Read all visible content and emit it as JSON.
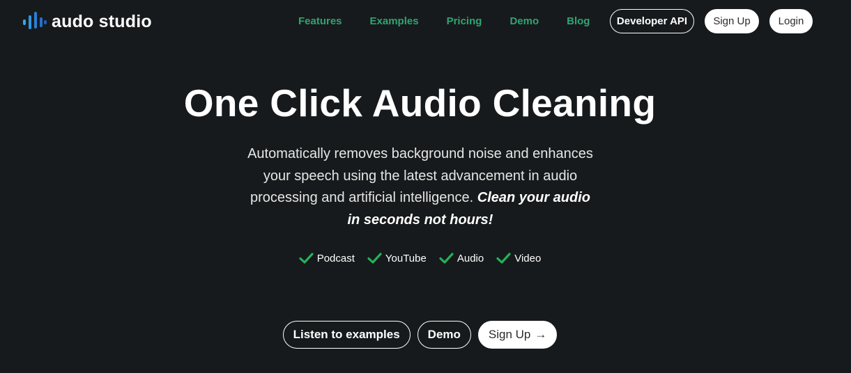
{
  "brand": {
    "name": "audo studio",
    "logo_colors": [
      "#3aa3e8",
      "#2c7fd4",
      "#1f5fc2"
    ]
  },
  "nav": {
    "items": [
      {
        "label": "Features"
      },
      {
        "label": "Examples"
      },
      {
        "label": "Pricing"
      },
      {
        "label": "Demo"
      },
      {
        "label": "Blog"
      }
    ],
    "link_color": "#2fa572"
  },
  "header_buttons": {
    "developer_api": "Developer API",
    "sign_up": "Sign Up",
    "login": "Login"
  },
  "hero": {
    "title": "One Click Audio Cleaning",
    "description": "Automatically removes background noise and enhances your speech using the latest advancement in audio processing and artificial intelligence.",
    "description_emphasis": "Clean your audio in seconds not hours!"
  },
  "features": {
    "check_color": "#22b35a",
    "icon": "check-icon",
    "items": [
      {
        "label": "Podcast"
      },
      {
        "label": "YouTube"
      },
      {
        "label": "Audio"
      },
      {
        "label": "Video"
      }
    ]
  },
  "cta": {
    "listen": "Listen to examples",
    "demo": "Demo",
    "sign_up": "Sign Up",
    "sign_up_icon": "arrow-right-icon",
    "arrow_glyph": "→"
  },
  "colors": {
    "background": "#171a1c",
    "text": "#ffffff"
  }
}
